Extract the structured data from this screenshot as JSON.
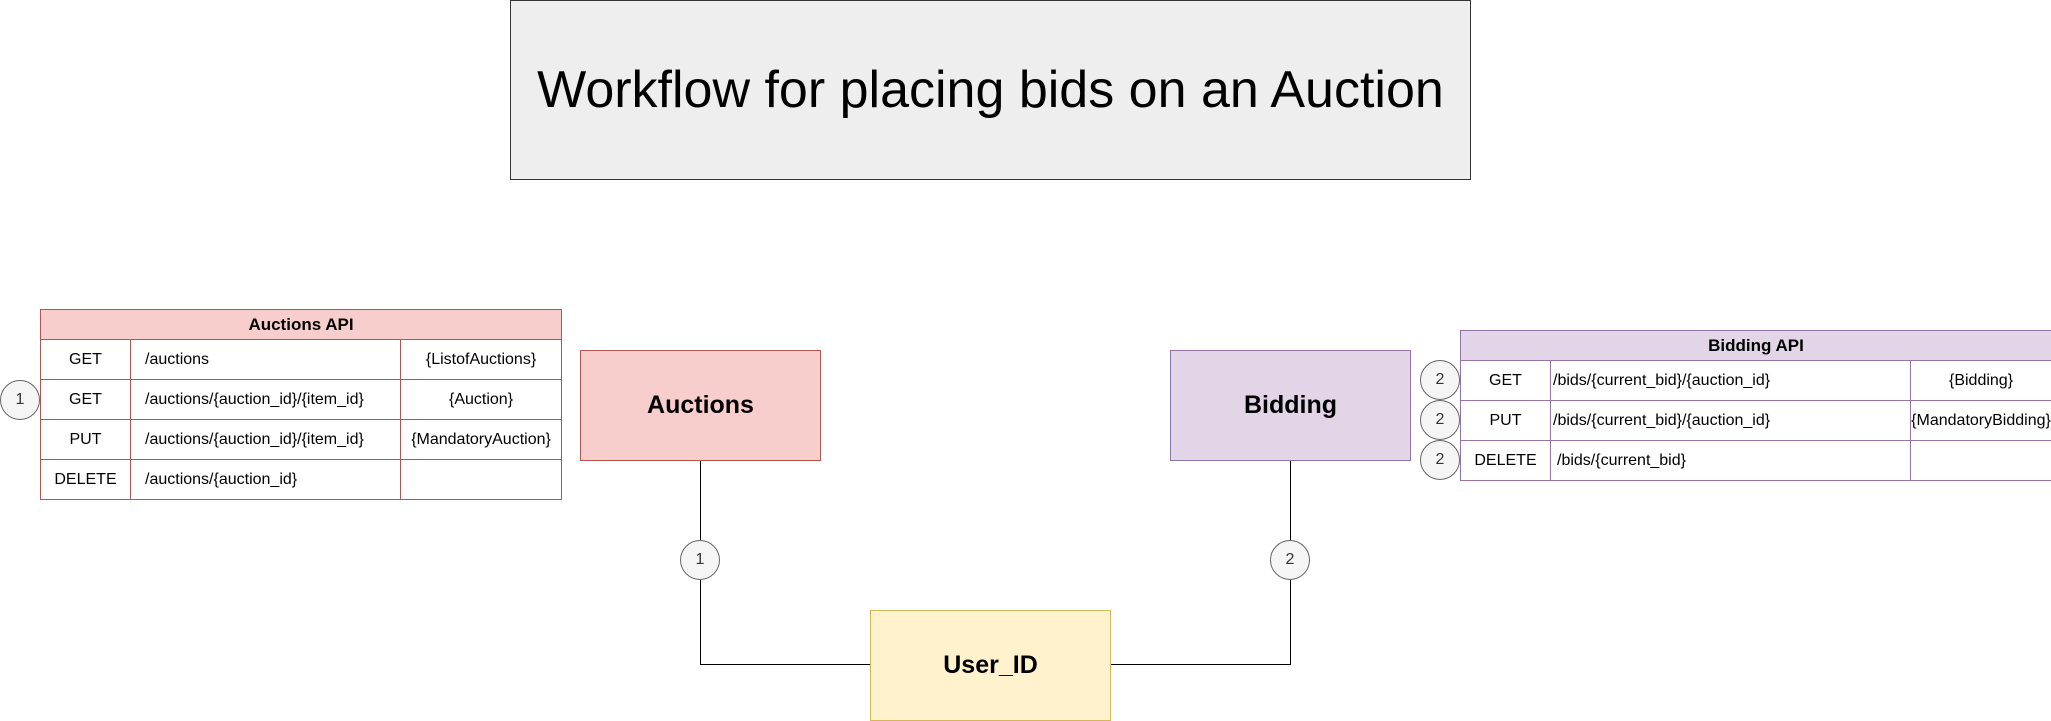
{
  "title": "Workflow for placing bids on an Auction",
  "entities": {
    "auctions": "Auctions",
    "bidding": "Bidding",
    "user_id": "User_ID"
  },
  "connectors": {
    "auctions_step": "1",
    "bidding_step": "2"
  },
  "auctions_api": {
    "header": "Auctions API",
    "rows": [
      {
        "step": "",
        "method": "GET",
        "path": "/auctions",
        "body": "{ListofAuctions}"
      },
      {
        "step": "1",
        "method": "GET",
        "path": "/auctions/{auction_id}/{item_id}",
        "body": "{Auction}"
      },
      {
        "step": "",
        "method": "PUT",
        "path": "/auctions/{auction_id}/{item_id}",
        "body": "{MandatoryAuction}"
      },
      {
        "step": "",
        "method": "DELETE",
        "path": "/auctions/{auction_id}",
        "body": ""
      }
    ]
  },
  "bidding_api": {
    "header": "Bidding API",
    "rows": [
      {
        "step": "2",
        "method": "GET",
        "path": "/bids/{current_bid}/{auction_id}",
        "body": "{Bidding}"
      },
      {
        "step": "2",
        "method": "PUT",
        "path": "/bids/{current_bid}/{auction_id}",
        "body": "{MandatoryBidding}"
      },
      {
        "step": "2",
        "method": "DELETE",
        "path": "/bids/{current_bid}",
        "body": ""
      }
    ]
  },
  "colors": {
    "auctions_fill": "#f8cecc",
    "auctions_stroke": "#b85450",
    "bidding_fill": "#e1d5e7",
    "bidding_stroke": "#9673a6",
    "user_fill": "#fff2cc",
    "user_stroke": "#d6b656",
    "title_fill": "#eeeeee"
  }
}
